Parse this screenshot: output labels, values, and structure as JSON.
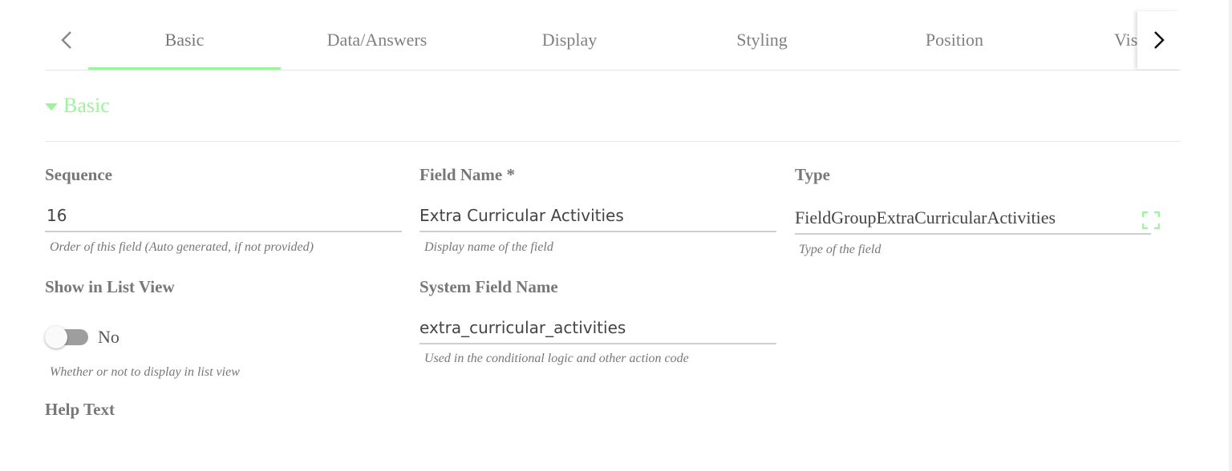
{
  "tabs": [
    {
      "label": "Basic",
      "active": true
    },
    {
      "label": "Data/Answers",
      "active": false
    },
    {
      "label": "Display",
      "active": false
    },
    {
      "label": "Styling",
      "active": false
    },
    {
      "label": "Position",
      "active": false
    },
    {
      "label": "Visibility",
      "active": false
    }
  ],
  "section": {
    "title": "Basic"
  },
  "fields": {
    "sequence": {
      "label": "Sequence",
      "value": "16",
      "hint": "Order of this field (Auto generated, if not provided)"
    },
    "field_name": {
      "label": "Field Name *",
      "value": "Extra Curricular Activities",
      "hint": "Display name of the field"
    },
    "type": {
      "label": "Type",
      "value": "FieldGroupExtraCurricularActivities",
      "hint": "Type of the field"
    },
    "show_in_list_view": {
      "label": "Show in List View",
      "value_text": "No",
      "hint": "Whether or not to display in list view"
    },
    "system_field_name": {
      "label": "System Field Name",
      "value": "extra_curricular_activities",
      "hint": "Used in the conditional logic and other action code"
    },
    "help_text": {
      "label": "Help Text"
    }
  },
  "colors": {
    "accent": "#9cf59c",
    "label": "#777777",
    "toggle_track": "#9e9e9e"
  },
  "icons": {
    "prev": "chevron-left-icon",
    "next": "chevron-right-icon",
    "section": "caret-down-icon",
    "type_picker": "expand-icon"
  }
}
